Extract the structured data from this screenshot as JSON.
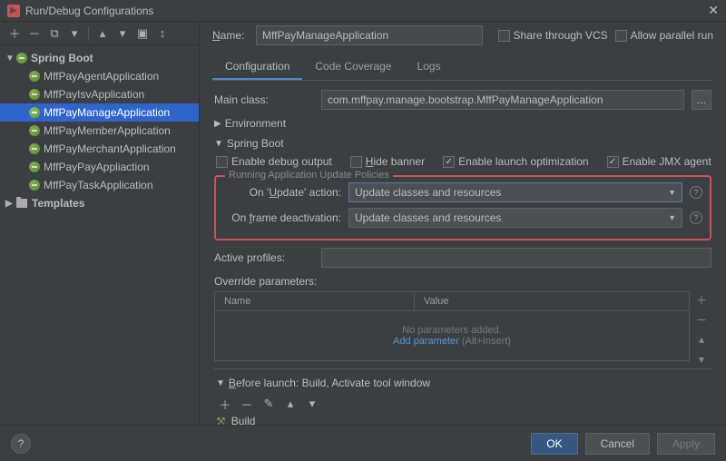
{
  "window": {
    "title": "Run/Debug Configurations"
  },
  "sidebar": {
    "root": {
      "label": "Spring Boot"
    },
    "items": [
      {
        "label": "MffPayAgentApplication"
      },
      {
        "label": "MffPayIsvApplication"
      },
      {
        "label": "MffPayManageApplication"
      },
      {
        "label": "MffPayMemberApplication"
      },
      {
        "label": "MffPayMerchantApplication"
      },
      {
        "label": "MffPayPayAppliaction"
      },
      {
        "label": "MffPayTaskApplication"
      }
    ],
    "templates": {
      "label": "Templates"
    }
  },
  "form": {
    "name_label": "Name:",
    "name_value": "MffPayManageApplication",
    "share_vcs": "Share through VCS",
    "allow_parallel": "Allow parallel run",
    "tabs": {
      "config": "Configuration",
      "coverage": "Code Coverage",
      "logs": "Logs"
    },
    "main_class_label": "Main class:",
    "main_class_value": "com.mffpay.manage.bootstrap.MffPayManageApplication",
    "env_section": "Environment",
    "sb_section": "Spring Boot",
    "enable_debug": "Enable debug output",
    "hide_banner": "Hide banner",
    "enable_launch_opt": "Enable launch optimization",
    "enable_jmx": "Enable JMX agent",
    "policies_label": "Running Application Update Policies",
    "on_update_label": "On 'Update' action:",
    "on_update_value": "Update classes and resources",
    "on_frame_label": "On frame deactivation:",
    "on_frame_value": "Update classes and resources",
    "active_profiles_label": "Active profiles:",
    "override_params_label": "Override parameters:",
    "col_name": "Name",
    "col_value": "Value",
    "no_params": "No parameters added.",
    "add_param": "Add parameter",
    "add_param_hint": "(Alt+Insert)",
    "before_launch": "Before launch: Build, Activate tool window",
    "build_item": "Build"
  },
  "footer": {
    "ok": "OK",
    "cancel": "Cancel",
    "apply": "Apply"
  }
}
